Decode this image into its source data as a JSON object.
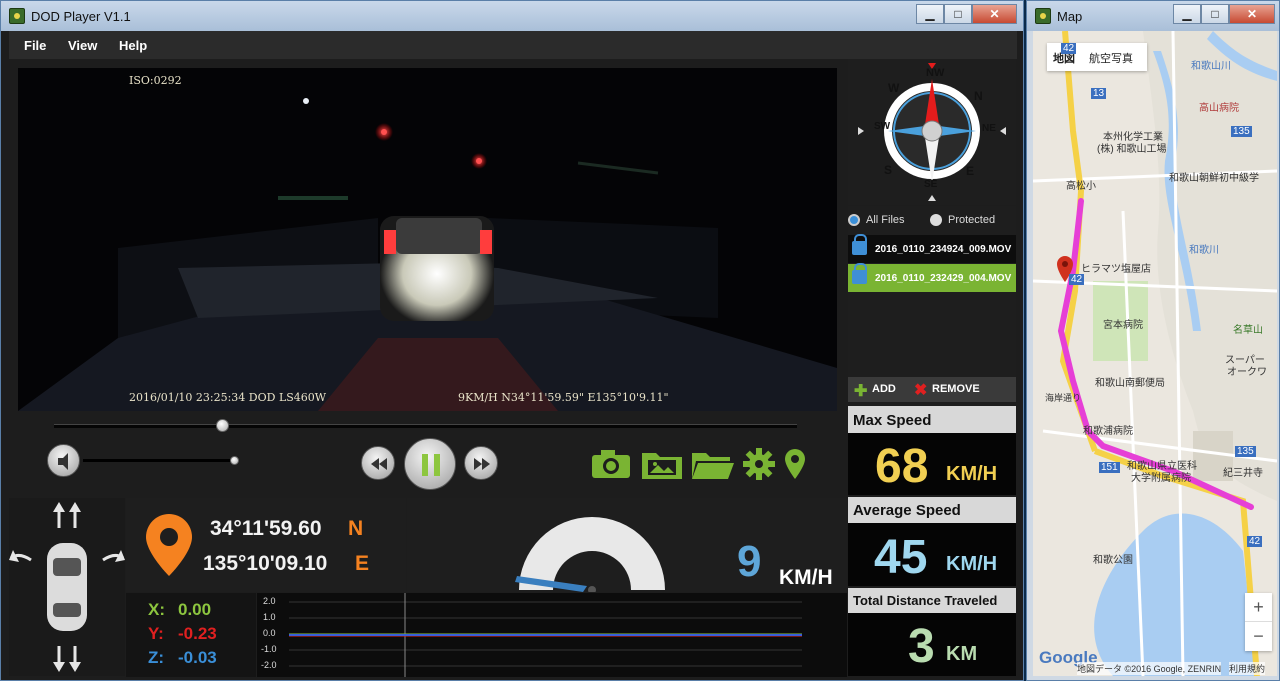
{
  "player": {
    "title": "DOD Player V1.1",
    "menu": [
      "File",
      "View",
      "Help"
    ],
    "osd": {
      "iso": "ISO:0292",
      "timestamp": "2016/01/10 23:25:34 DOD LS460W",
      "telemetry": "9KM/H N34°11'59.59\" E135°10'9.11\""
    },
    "coordinates": {
      "lat": "34°11'59.60",
      "lat_dir": "N",
      "lon": "135°10'09.10",
      "lon_dir": "E"
    },
    "gauge": {
      "speed": "9",
      "unit": "KM/H"
    },
    "gsensor": {
      "x_label": "X:",
      "x_value": "0.00",
      "y_label": "Y:",
      "y_value": "-0.23",
      "z_label": "Z:",
      "z_value": "-0.03",
      "ticks": [
        "2.0",
        "1.0",
        "0.0",
        "-1.0",
        "-2.0"
      ]
    },
    "files": {
      "filter_all": "All Files",
      "filter_protected": "Protected",
      "items": [
        "2016_0110_234924_009.MOV",
        "2016_0110_232429_004.MOV"
      ],
      "add_label": "ADD",
      "remove_label": "REMOVE"
    },
    "stats": {
      "max_speed_title": "Max Speed",
      "max_speed_value": "68",
      "max_speed_unit": "KM/H",
      "avg_speed_title": "Average Speed",
      "avg_speed_value": "45",
      "avg_speed_unit": "KM/H",
      "distance_title": "Total Distance Traveled",
      "distance_value": "3",
      "distance_unit": "KM"
    },
    "compass": {
      "n": "N",
      "ne": "NE",
      "e": "E",
      "se": "SE",
      "s": "S",
      "sw": "SW",
      "w": "W",
      "nw": "NW"
    }
  },
  "map": {
    "title": "Map",
    "tab_map": "地図",
    "tab_satellite": "航空写真",
    "labels": {
      "wakayama_river": "和歌山川",
      "takamatsu_hosp": "高山病院",
      "honshu": "本州化学工業",
      "honshu2": "(株) 和歌山工場",
      "takamatsu_sho": "高松小",
      "wakayama_chugaku": "和歌山朝鮮初中級学",
      "hiramatsu": "ヒラマツ塩屋店",
      "miyamoto": "宮本病院",
      "nankai_post": "和歌山南郵便局",
      "kaigan": "海岸通り",
      "wakaura_hosp": "和歌浦病院",
      "medical": "和歌山県立医科",
      "medical2": "大学附属病院",
      "kimii": "紀三井寺",
      "park": "和歌公園",
      "super": "スーパー",
      "super2": "オークワ",
      "meiou": "名草山",
      "wakayama_e": "和歌川",
      "route13": "13",
      "route135a": "135",
      "route135b": "135",
      "route42a": "42",
      "route42b": "42",
      "route42c": "42",
      "route151": "151",
      "route42top": "42"
    },
    "footer_logo": "Google",
    "footer_data": "地図データ ©2016 Google, ZENRIN",
    "footer_terms": "利用規約",
    "zoom_in": "+",
    "zoom_out": "−"
  },
  "colors": {
    "accent_orange": "#f58220",
    "route_magenta": "#e63fd6",
    "max_speed": "#f1cf52",
    "avg_speed": "#9fd7ef",
    "distance": "#b9dcb0",
    "icon_green": "#7ab433"
  }
}
